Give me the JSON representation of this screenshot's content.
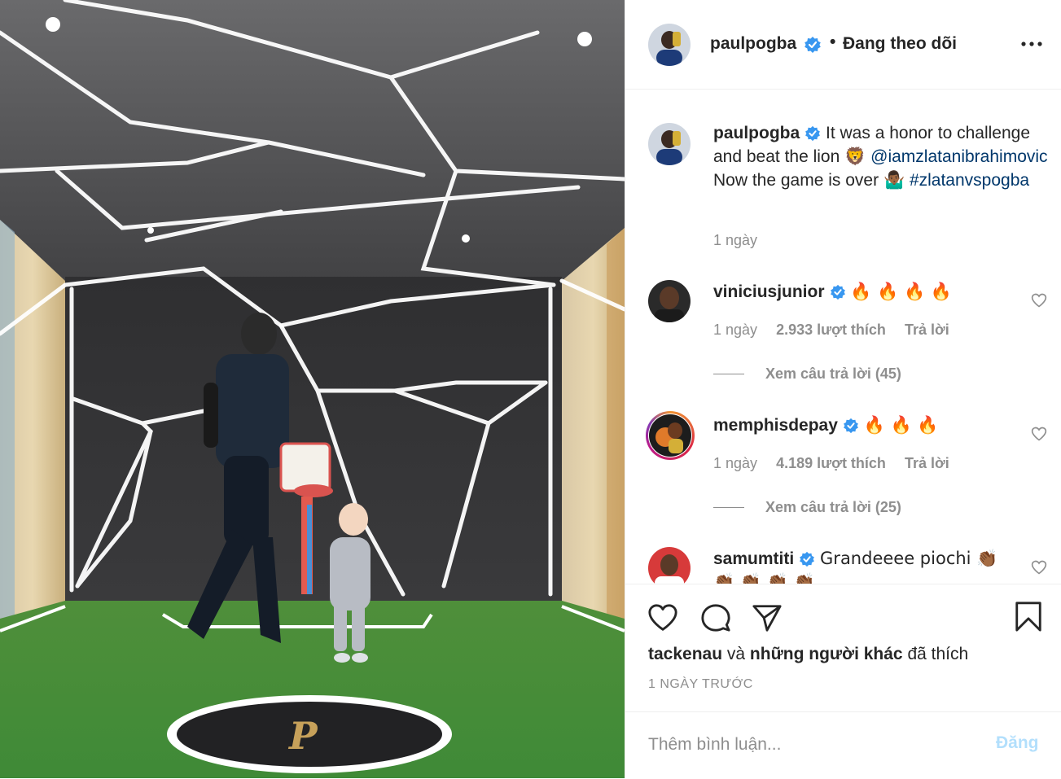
{
  "header": {
    "username": "paulpogba",
    "separator": "•",
    "follow_status": "Đang theo dõi"
  },
  "caption": {
    "username": "paulpogba",
    "text_1": "It was a honor to challenge and beat the lion",
    "emoji_1": "🦁",
    "mention": "@iamzlatanibrahimovic",
    "text_2": "Now the game is over",
    "emoji_2": "🤷🏾‍♂️",
    "hashtag": "#zlatanvspogba",
    "time": "1 ngày"
  },
  "comments": [
    {
      "username": "viniciusjunior",
      "text": "🔥 🔥 🔥 🔥",
      "time": "1 ngày",
      "likes": "2.933 lượt thích",
      "reply": "Trả lời",
      "view_replies": "Xem câu trả lời (45)"
    },
    {
      "username": "memphisdepay",
      "text": "🔥 🔥 🔥",
      "time": "1 ngày",
      "likes": "4.189 lượt thích",
      "reply": "Trả lời",
      "view_replies": "Xem câu trả lời (25)"
    },
    {
      "username": "samumtiti",
      "text": "Grandeeee piochi 👏🏾",
      "text_overflow": "👏🏾 👏🏾 👏🏾 👏🏾"
    }
  ],
  "actions": {
    "liked_by_user": "tackenau",
    "liked_by_connector": "và",
    "liked_by_others": "những người khác",
    "liked_by_suffix": "đã thích",
    "date": "1 NGÀY TRƯỚC"
  },
  "add_comment": {
    "placeholder": "Thêm bình luận...",
    "post_label": "Đăng"
  },
  "colors": {
    "text": "#262626",
    "muted": "#8e8e8e",
    "link": "#00376b",
    "verified": "#3897f0",
    "post_disabled": "#b2dffc"
  },
  "icons": [
    "verified-badge-icon",
    "more-options-icon",
    "heart-icon",
    "comment-icon",
    "share-icon",
    "bookmark-icon"
  ]
}
